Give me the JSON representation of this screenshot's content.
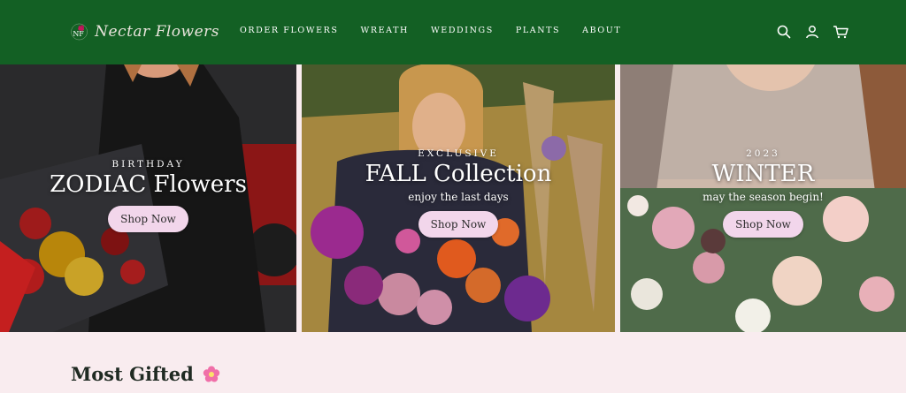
{
  "header": {
    "logo_monogram": "NF",
    "logo_text": "Nectar Flowers",
    "nav": [
      {
        "label": "ORDER FLOWERS"
      },
      {
        "label": "WREATH"
      },
      {
        "label": "WEDDINGS"
      },
      {
        "label": "PLANTS"
      },
      {
        "label": "ABOUT"
      }
    ],
    "icons": [
      "search-icon",
      "account-icon",
      "cart-icon"
    ],
    "bg_color": "#136024"
  },
  "hero": {
    "panels": [
      {
        "eyebrow": "BIRTHDAY",
        "headline": "ZODIAC Flowers",
        "sub": "",
        "button": "Shop Now"
      },
      {
        "eyebrow": "EXCLUSIVE",
        "headline": "FALL Collection",
        "sub": "enjoy the last days",
        "button": "Shop Now"
      },
      {
        "eyebrow": "2023",
        "headline": "WINTER",
        "sub": "may the season begin!",
        "button": "Shop Now"
      }
    ],
    "button_color": "#f2d6eb"
  },
  "section": {
    "title": "Most Gifted",
    "emoji_icon": "flower-icon"
  }
}
